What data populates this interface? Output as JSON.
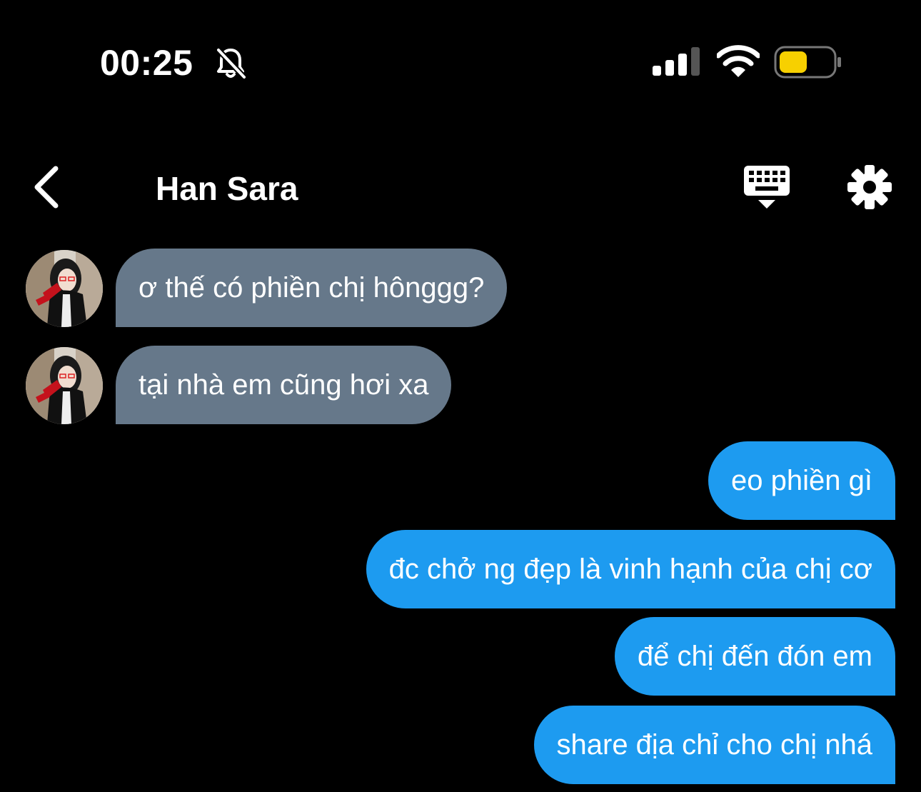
{
  "status_bar": {
    "time": "00:25",
    "icons": [
      "bell-slash-icon",
      "cellular-signal-icon",
      "wifi-icon",
      "battery-icon"
    ],
    "battery_color": "#f7d000"
  },
  "header": {
    "back_icon": "chevron-left-icon",
    "title": "Han Sara",
    "keyboard_icon": "keyboard-hide-icon",
    "settings_icon": "gear-icon"
  },
  "messages": [
    {
      "direction": "incoming",
      "text": "ơ thế có phiền chị hônggg?"
    },
    {
      "direction": "incoming",
      "text": "tại nhà em cũng hơi xa"
    },
    {
      "direction": "outgoing",
      "text": "eo phiền gì"
    },
    {
      "direction": "outgoing",
      "text": "đc chở ng đẹp là vinh hạnh của chị cơ"
    },
    {
      "direction": "outgoing",
      "text": "để chị đến đón em"
    },
    {
      "direction": "outgoing",
      "text": "share địa chỉ cho chị nhá"
    }
  ],
  "colors": {
    "incoming_bubble": "#66788a",
    "outgoing_bubble": "#1d9bf0",
    "background": "#000000"
  }
}
